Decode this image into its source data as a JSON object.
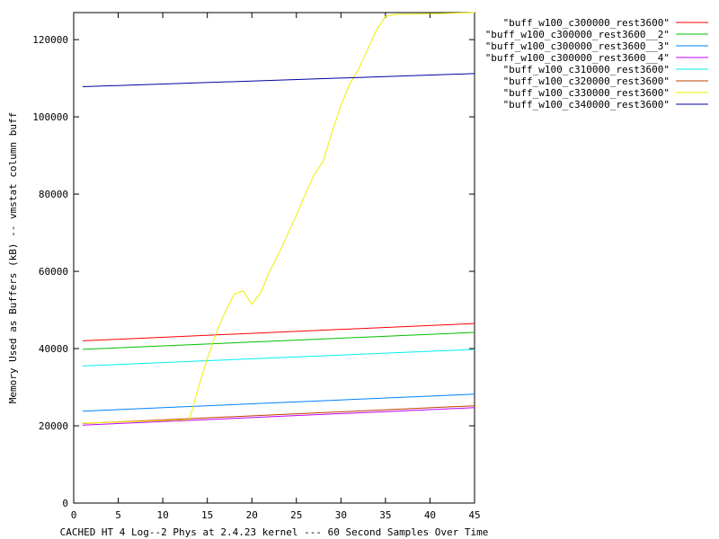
{
  "chart_data": {
    "type": "line",
    "xlabel": "CACHED HT 4 Log--2 Phys at 2.4.23 kernel --- 60 Second Samples Over Time",
    "ylabel": "Memory Used as Buffers (kB) -- vmstat column buff",
    "xlim": [
      0,
      45
    ],
    "ylim": [
      0,
      127000
    ],
    "x_ticks": [
      0,
      5,
      10,
      15,
      20,
      25,
      30,
      35,
      40,
      45
    ],
    "y_ticks": [
      0,
      20000,
      40000,
      60000,
      80000,
      100000,
      120000
    ],
    "grid": false,
    "legend_position": "top-right outside",
    "series": [
      {
        "name": "\"buff_w100_c300000_rest3600\"",
        "color": "#ff0000",
        "x": [
          1,
          45
        ],
        "y": [
          42000,
          46500
        ]
      },
      {
        "name": "\"buff_w100_c300000_rest3600__2\"",
        "color": "#00c000",
        "x": [
          1,
          45
        ],
        "y": [
          39800,
          44200
        ]
      },
      {
        "name": "\"buff_w100_c300000_rest3600__3\"",
        "color": "#0080ff",
        "x": [
          1,
          45
        ],
        "y": [
          23800,
          28200
        ]
      },
      {
        "name": "\"buff_w100_c300000_rest3600__4\"",
        "color": "#c000ff",
        "x": [
          1,
          45
        ],
        "y": [
          20200,
          24700
        ]
      },
      {
        "name": "\"buff_w100_c310000_rest3600\"",
        "color": "#00eeee",
        "x": [
          1,
          45
        ],
        "y": [
          35500,
          39800
        ]
      },
      {
        "name": "\"buff_w100_c320000_rest3600\"",
        "color": "#c04000",
        "x": [
          1,
          45
        ],
        "y": [
          20600,
          25200
        ]
      },
      {
        "name": "\"buff_w100_c330000_rest3600\"",
        "color": "#eeee00",
        "x": [
          1,
          7,
          13,
          14,
          15,
          16,
          17,
          18,
          19,
          20,
          21,
          22,
          23,
          24,
          25,
          26,
          27,
          28,
          29,
          30,
          31,
          32,
          33,
          34,
          35,
          36,
          40,
          45
        ],
        "y": [
          20700,
          21100,
          21600,
          30000,
          37500,
          44000,
          49500,
          54000,
          55000,
          51500,
          54500,
          60000,
          64500,
          69500,
          74500,
          80000,
          85000,
          88500,
          96000,
          103000,
          108500,
          112500,
          117500,
          122500,
          126000,
          126500,
          126700,
          127000
        ]
      },
      {
        "name": "\"buff_w100_c340000_rest3600\"",
        "color": "#0000a0",
        "x": [
          1,
          45
        ],
        "y": [
          107800,
          111200
        ]
      }
    ]
  }
}
